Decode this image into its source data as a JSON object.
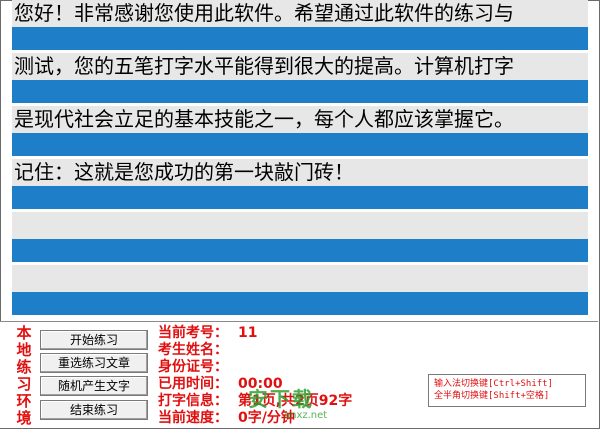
{
  "practice": {
    "lines": [
      {
        "text": "您好！非常感谢您使用此软件。希望通过此软件的练习与",
        "input": ""
      },
      {
        "text": "测试，您的五笔打字水平能得到很大的提高。计算机打字",
        "input": ""
      },
      {
        "text": "是现代社会立足的基本技能之一，每个人都应该掌握它。",
        "input": ""
      },
      {
        "text": "记住：这就是您成功的第一块敲门砖！",
        "input": ""
      },
      {
        "text": "",
        "input": ""
      },
      {
        "text": "",
        "input": ""
      }
    ]
  },
  "panel": {
    "title_chars": [
      "本",
      "地",
      "练",
      "习",
      "环",
      "境"
    ],
    "buttons": {
      "start": "开始练习",
      "reselect": "重选练习文章",
      "random": "随机产生文字",
      "end": "结束练习"
    },
    "info": {
      "exam_no_label": "当前考号：",
      "exam_no_value": "11",
      "name_label": "考生姓名：",
      "name_value": "",
      "id_label": "身份证号：",
      "id_value": "",
      "time_label": "已用时间：",
      "time_value": "00:00",
      "typing_label": "打字信息：",
      "typing_value": "第1页,共2页92字",
      "speed_label": "当前速度：",
      "speed_value": "0字/分钟"
    },
    "hints": {
      "line1": "输入法切换键[Ctrl+Shift]",
      "line2": "全半角切换键[Shift+空格]"
    }
  },
  "watermark": {
    "text": "安下载",
    "url": "anxz.net"
  },
  "colors": {
    "input_bar": "#1e7ec7",
    "source_bg": "#e7e7e7",
    "label_red": "#e01010"
  }
}
